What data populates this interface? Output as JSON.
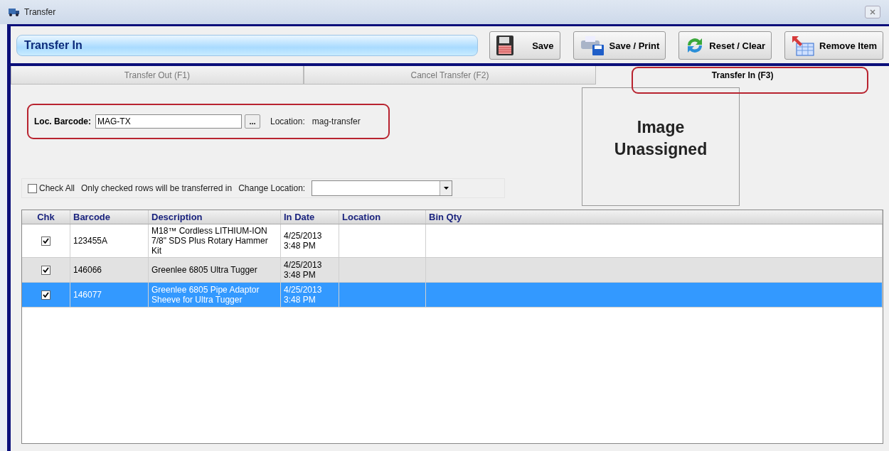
{
  "window": {
    "title": "Transfer"
  },
  "header": {
    "title": "Transfer In"
  },
  "toolbar": [
    {
      "kind": "save",
      "label": "Save"
    },
    {
      "kind": "print",
      "label": "Save / Print"
    },
    {
      "kind": "reset",
      "label": "Reset / Clear"
    },
    {
      "kind": "remove",
      "label": "Remove Item"
    }
  ],
  "tabs": [
    {
      "label": "Transfer Out (F1)",
      "selected": false
    },
    {
      "label": "Cancel Transfer (F2)",
      "selected": false
    },
    {
      "label": "Transfer In (F3)",
      "selected": true
    }
  ],
  "location": {
    "label": "Loc. Barcode:",
    "value": "MAG-TX",
    "browse": "...",
    "location_label": "Location:",
    "location_value": "mag-transfer"
  },
  "image": {
    "text": "Image Unassigned"
  },
  "options": {
    "check_all": {
      "label": "Check All",
      "checked": false
    },
    "note": "Only checked rows will be transferred in",
    "change_location_label": "Change Location:"
  },
  "table": {
    "columns": [
      "Chk",
      "Barcode",
      "Description",
      "In Date",
      "Location",
      "Bin Qty"
    ],
    "rows": [
      {
        "checked": true,
        "selected": false,
        "barcode": "123455A",
        "description": "M18™ Cordless LITHIUM-ION 7/8\" SDS Plus Rotary Hammer Kit",
        "in_date": "4/25/2013 3:48 PM"
      },
      {
        "checked": true,
        "selected": false,
        "barcode": "146066",
        "description": "Greenlee 6805 Ultra Tugger",
        "in_date": "4/25/2013 3:48 PM"
      },
      {
        "checked": true,
        "selected": true,
        "barcode": "146077",
        "description": "Greenlee 6805  Pipe Adaptor Sheeve for Ultra Tugger",
        "in_date": "4/25/2013 3:48 PM"
      }
    ]
  }
}
